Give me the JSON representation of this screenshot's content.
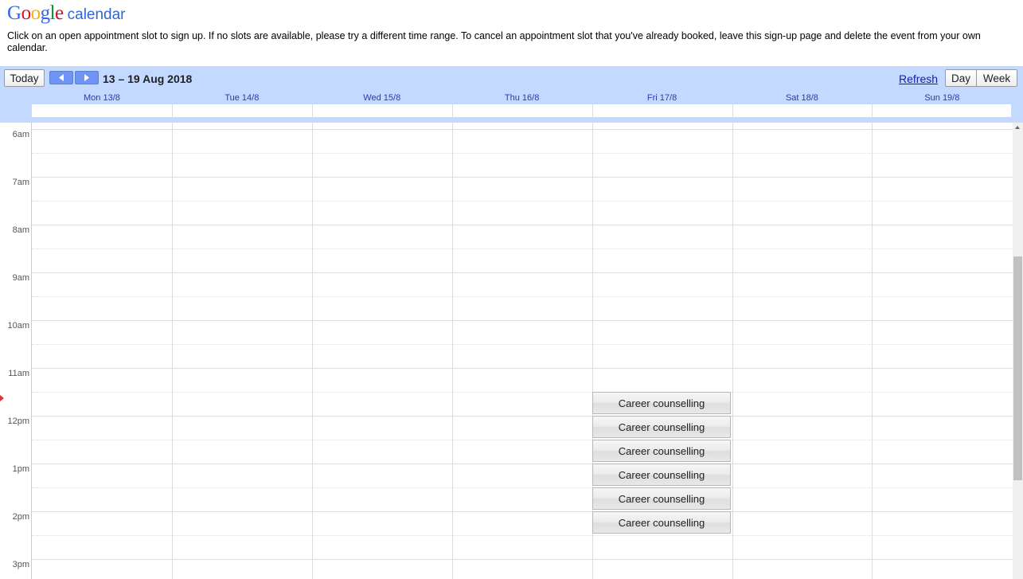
{
  "logo": {
    "google": "Google",
    "calendar": "calendar"
  },
  "instructions": "Click on an open appointment slot to sign up. If no slots are available, please try a different time range. To cancel an appointment slot that you've already booked, leave this sign-up page and delete the event from your own calendar.",
  "toolbar": {
    "today_label": "Today",
    "date_range": "13 – 19 Aug 2018",
    "refresh_label": "Refresh",
    "day_label": "Day",
    "week_label": "Week"
  },
  "days": [
    "Mon 13/8",
    "Tue 14/8",
    "Wed 15/8",
    "Thu 16/8",
    "Fri 17/8",
    "Sat 18/8",
    "Sun 19/8"
  ],
  "times": [
    "6am",
    "7am",
    "8am",
    "9am",
    "10am",
    "11am",
    "12pm",
    "1pm",
    "2pm",
    "3pm"
  ],
  "slots": [
    {
      "day": "Fri 17/8",
      "label": "Career counselling"
    },
    {
      "day": "Fri 17/8",
      "label": "Career counselling"
    },
    {
      "day": "Fri 17/8",
      "label": "Career counselling"
    },
    {
      "day": "Fri 17/8",
      "label": "Career counselling"
    },
    {
      "day": "Fri 17/8",
      "label": "Career counselling"
    },
    {
      "day": "Fri 17/8",
      "label": "Career counselling"
    }
  ],
  "colors": {
    "toolbar_bg": "#c3d9ff",
    "nav_button": "#6e95f5",
    "link": "#1a1aa6",
    "day_header_text": "#2b3aa8"
  }
}
